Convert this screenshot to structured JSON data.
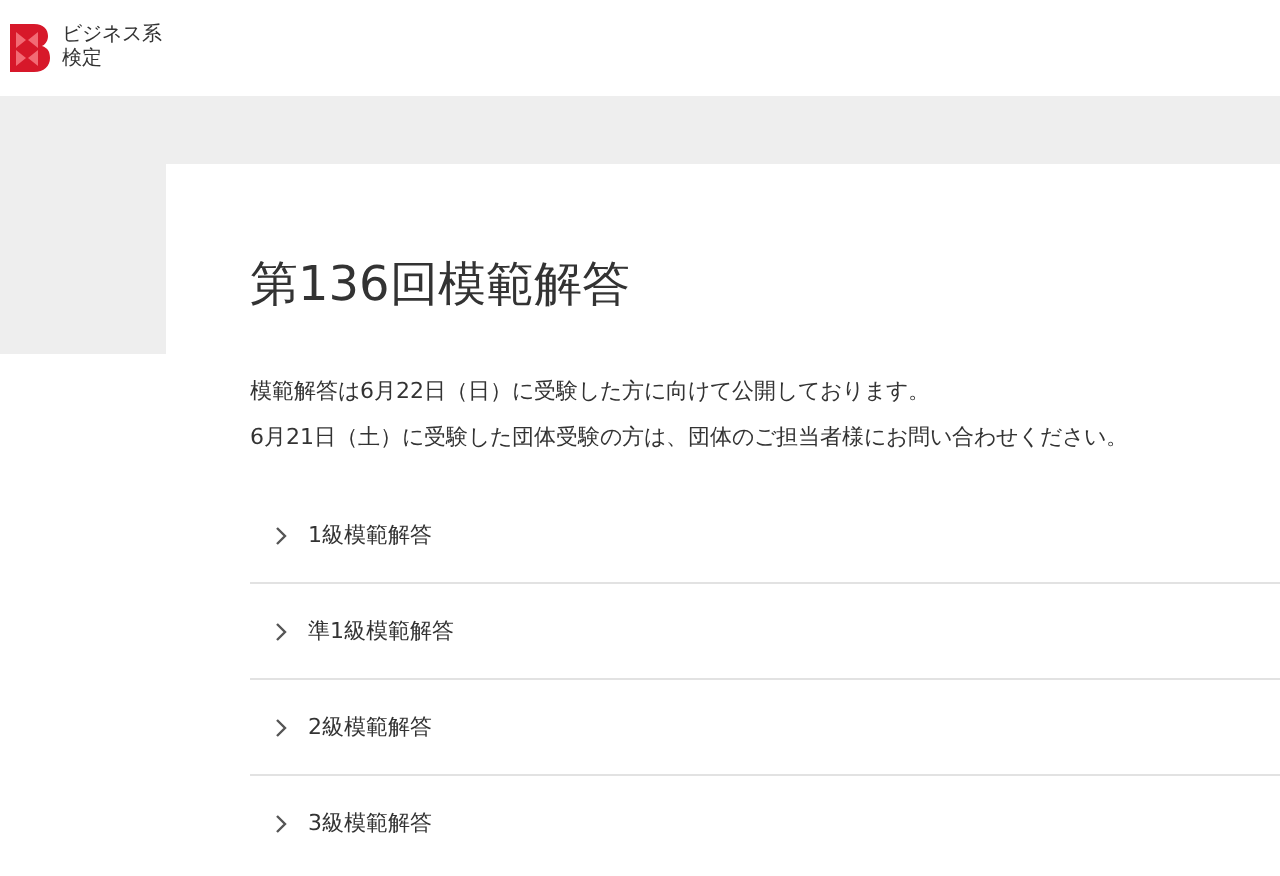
{
  "header": {
    "logo_text_line1": "ビジネス系",
    "logo_text_line2": "検定"
  },
  "page": {
    "title": "第136回模範解答",
    "notes": [
      "模範解答は6月22日（日）に受験した方に向けて公開しております。",
      "6月21日（土）に受験した団体受験の方は、団体のご担当者様にお問い合わせください。"
    ],
    "accordion": [
      {
        "label": "1級模範解答",
        "expanded": false
      },
      {
        "label": "準1級模範解答",
        "expanded": false
      },
      {
        "label": "2級模範解答",
        "expanded": false
      },
      {
        "label": "3級模範解答",
        "expanded": false
      }
    ]
  }
}
